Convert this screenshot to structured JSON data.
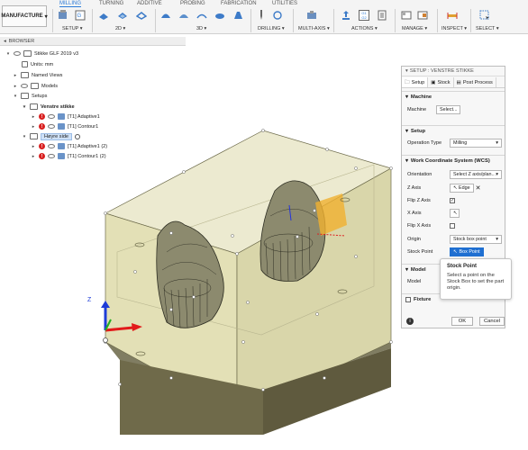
{
  "toolbar": {
    "workspace": "MANUFACTURE",
    "tabs": [
      "MILLING",
      "TURNING",
      "ADDITIVE",
      "PROBING",
      "FABRICATION",
      "UTILITIES"
    ],
    "groups": [
      "SETUP",
      "2D",
      "3D",
      "DRILLING",
      "MULTI-AXIS",
      "ACTIONS",
      "MANAGE",
      "INSPECT",
      "SELECT"
    ],
    "g_icon_text": "G1\nG2"
  },
  "browser": {
    "title": "BROWSER",
    "doc": "Stikke GLF 2019 v3",
    "units": "Units: mm",
    "named_views": "Named Views",
    "models": "Models",
    "setups": "Setups",
    "setup1": "Venstre stikke",
    "op1": "[T1] Adaptive1",
    "op2": "[T1] Contour1",
    "setup2": "Høyre side",
    "op3": "[T1] Adaptive1 (2)",
    "op4": "[T1] Contour1 (2)"
  },
  "panel": {
    "title": "SETUP : VENSTRE STIKKE",
    "tabs": [
      "Setup",
      "Stock",
      "Post Process"
    ],
    "machine_section": "Machine",
    "machine_label": "Machine",
    "machine_btn": "Select...",
    "setup_section": "Setup",
    "op_type_label": "Operation Type",
    "op_type_value": "Milling",
    "wcs_section": "Work Coordinate System (WCS)",
    "orientation_label": "Orientation",
    "orientation_value": "Select Z axis/plan...",
    "z_axis_label": "Z Axis",
    "z_axis_value": "Edge",
    "flip_z_label": "Flip Z Axis",
    "x_axis_label": "X Axis",
    "flip_x_label": "Flip X Axis",
    "origin_label": "Origin",
    "origin_value": "Stock box point",
    "stock_point_label": "Stock Point",
    "stock_point_btn": "Box Point",
    "model_section": "Model",
    "model_label": "Model",
    "fixture_section": "Fixture",
    "ok": "OK",
    "cancel": "Cancel"
  },
  "tooltip": {
    "title": "Stock Point",
    "body": "Select a point on the Stock Box to set the part origin."
  },
  "triad": {
    "z_label": "Z"
  },
  "colors": {
    "accent": "#1f6fd1",
    "stock_fill": "#e5e2b6",
    "stock_dark": "#6a6646",
    "error": "#d92020"
  }
}
